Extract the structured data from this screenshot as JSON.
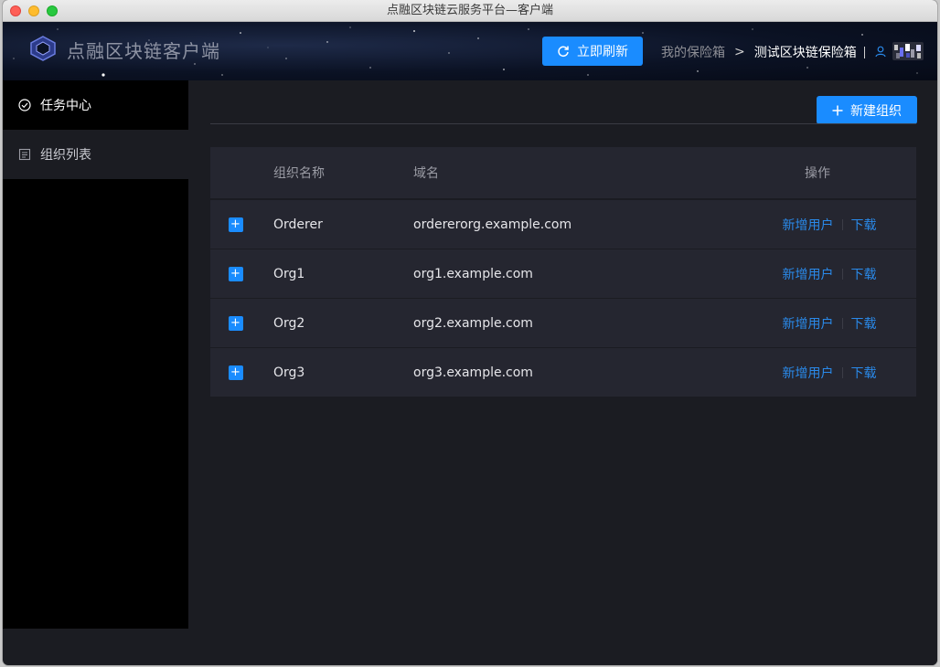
{
  "window": {
    "title": "点融区块链云服务平台—客户端"
  },
  "header": {
    "app_name": "点融区块链客户端",
    "refresh_label": "立即刷新",
    "breadcrumb": {
      "parent": "我的保险箱",
      "separator": ">",
      "current": "测试区块链保险箱"
    }
  },
  "sidebar": {
    "items": [
      {
        "label": "任务中心",
        "icon": "check-circle-icon"
      },
      {
        "label": "组织列表",
        "icon": "list-icon"
      }
    ]
  },
  "toolbar": {
    "new_org_label": "新建组织"
  },
  "table": {
    "columns": {
      "name": "组织名称",
      "domain": "域名",
      "ops": "操作"
    },
    "rows": [
      {
        "name": "Orderer",
        "domain": "ordererorg.example.com",
        "add_user": "新增用户",
        "download": "下载"
      },
      {
        "name": "Org1",
        "domain": "org1.example.com",
        "add_user": "新增用户",
        "download": "下载"
      },
      {
        "name": "Org2",
        "domain": "org2.example.com",
        "add_user": "新增用户",
        "download": "下载"
      },
      {
        "name": "Org3",
        "domain": "org3.example.com",
        "add_user": "新增用户",
        "download": "下载"
      }
    ],
    "expand_symbol": "+"
  },
  "colors": {
    "accent": "#1a8cff",
    "link": "#2a8aea",
    "background": "#1b1c22",
    "sidebar": "#000000",
    "row": "#252630"
  }
}
